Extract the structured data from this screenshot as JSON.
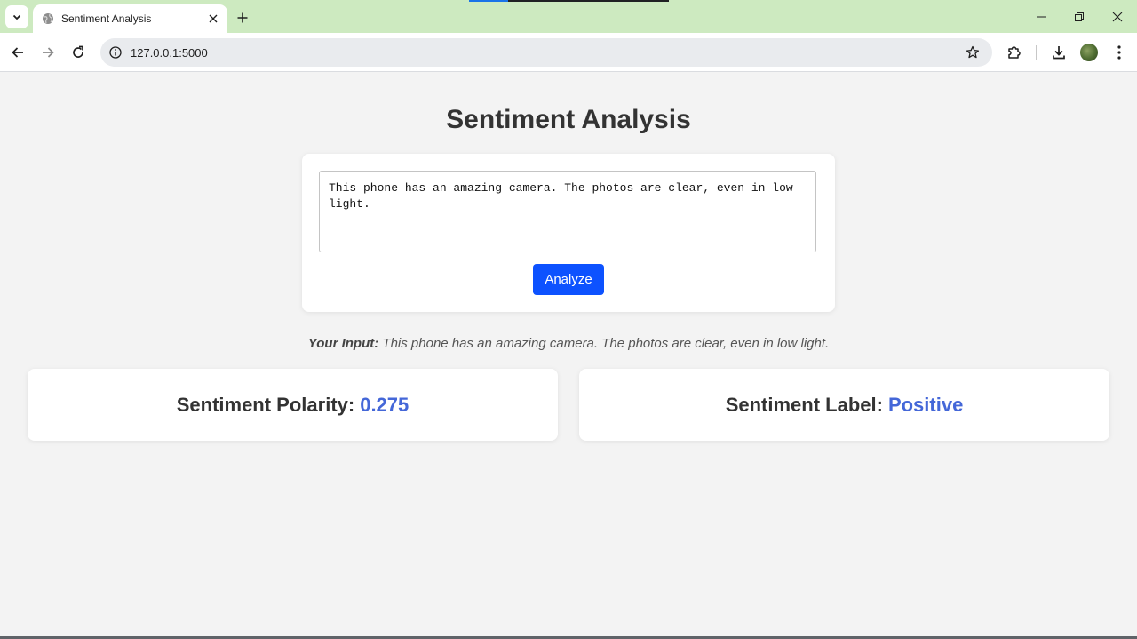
{
  "browser": {
    "tab_title": "Sentiment Analysis",
    "url": "127.0.0.1:5000"
  },
  "page": {
    "title": "Sentiment Analysis",
    "input_text": "This phone has an amazing camera. The photos are clear, even in low light.",
    "analyze_label": "Analyze",
    "your_input_label": "Your Input:",
    "your_input_value": "This phone has an amazing camera. The photos are clear, even in low light.",
    "polarity_label": "Sentiment Polarity:",
    "polarity_value": "0.275",
    "sentiment_label": "Sentiment Label:",
    "sentiment_value": "Positive"
  },
  "colors": {
    "tabbar_bg": "#cdeac0",
    "accent_button": "#0d52ff",
    "result_value": "#4467d8"
  },
  "icons": {
    "tab_search": "chevron-down-icon",
    "favicon": "globe-icon",
    "close": "close-icon",
    "new_tab": "plus-icon",
    "back": "back-arrow-icon",
    "forward": "forward-arrow-icon",
    "reload": "reload-icon",
    "site_info": "info-icon",
    "bookmark": "star-icon",
    "extensions": "puzzle-icon",
    "downloads": "download-icon",
    "menu": "kebab-menu-icon"
  }
}
